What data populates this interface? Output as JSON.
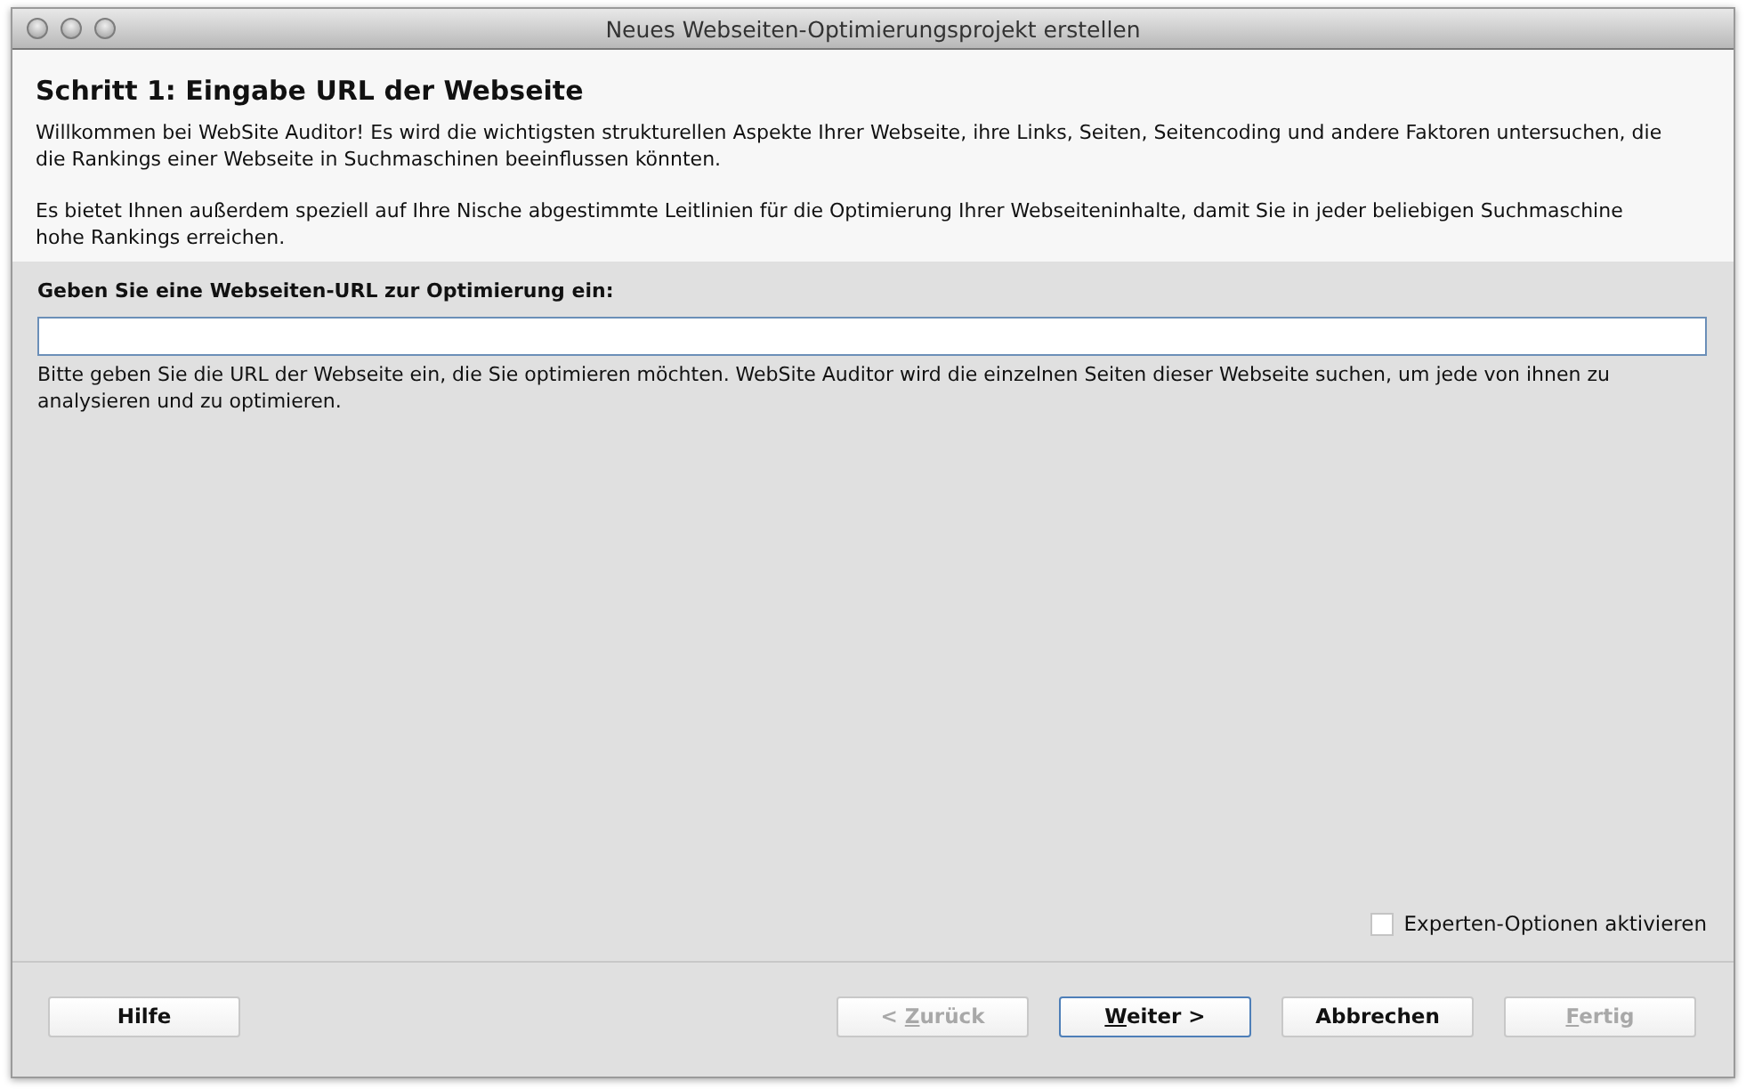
{
  "window": {
    "title": "Neues Webseiten-Optimierungsprojekt erstellen"
  },
  "header": {
    "heading": "Schritt 1: Eingabe URL der Webseite",
    "paragraphs": [
      "Willkommen bei WebSite Auditor! Es wird die wichtigsten strukturellen Aspekte Ihrer Webseite, ihre Links, Seiten, Seitencoding und andere Faktoren untersuchen, die die Rankings einer Webseite in Suchmaschinen beeinflussen könnten.",
      "Es bietet Ihnen außerdem speziell auf Ihre Nische abgestimmte Leitlinien für die Optimierung Ihrer Webseiteninhalte, damit Sie in jeder beliebigen Suchmaschine hohe Rankings erreichen."
    ]
  },
  "url_field": {
    "label": "Geben Sie eine Webseiten-URL zur Optimierung ein:",
    "hint": "Bitte geben Sie die URL der Webseite ein, die Sie optimieren möchten. WebSite Auditor wird die einzelnen Seiten dieser Webseite suchen, um jede von ihnen zu analysieren und zu optimieren."
  },
  "expert_options": {
    "label": "Experten-Optionen aktivieren",
    "checked": false
  },
  "help_button": {
    "label": "Hilfe"
  },
  "buttons": [
    {
      "before": "< ",
      "mnemonic": "Z",
      "after": "urück",
      "disabled": true,
      "default": false
    },
    {
      "mnemonic": "W",
      "after": "eiter >",
      "disabled": false,
      "default": true
    },
    {
      "before": "Abbrechen",
      "disabled": false,
      "default": false
    },
    {
      "mnemonic": "F",
      "after": "ertig",
      "disabled": true,
      "default": false
    }
  ]
}
